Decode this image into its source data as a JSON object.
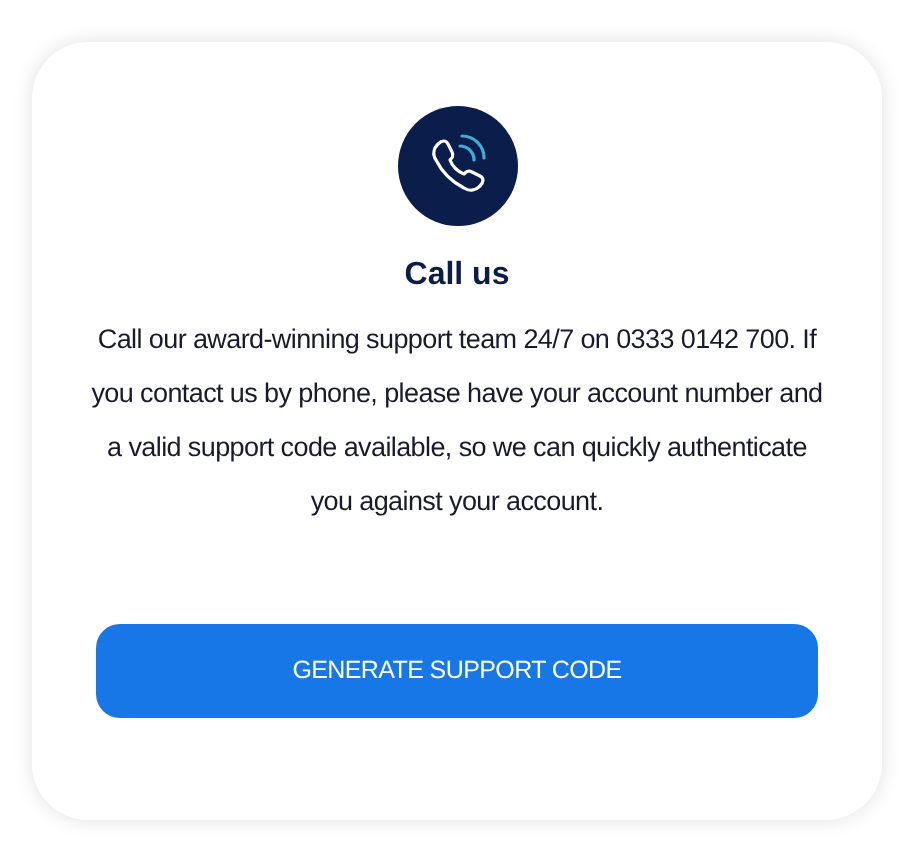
{
  "card": {
    "title": "Call us",
    "body": "Call our award-winning support team 24/7 on 0333 0142 700. If you contact us by phone, please have your account number and a valid support code available, so we can quickly authenticate you against your account.",
    "button": "GENERATE SUPPORT CODE"
  }
}
